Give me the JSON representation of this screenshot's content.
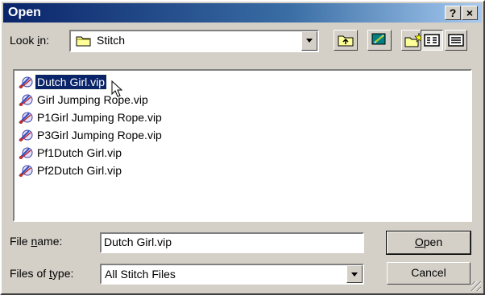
{
  "window": {
    "title": "Open",
    "help_label": "?",
    "close_label": "×"
  },
  "toolbar": {
    "look_in_label": "Look ",
    "look_in_accel": "i",
    "look_in_after": "n:",
    "look_in_value": "Stitch",
    "look_in_icon": "folder-icon",
    "buttons": [
      {
        "name": "up-one-level-button",
        "icon": "up-folder-icon"
      },
      {
        "name": "desktop-button",
        "icon": "desktop-icon"
      },
      {
        "name": "new-folder-button",
        "icon": "new-folder-icon"
      },
      {
        "name": "list-view-button",
        "icon": "list-view-icon",
        "pressed": true
      },
      {
        "name": "details-view-button",
        "icon": "details-view-icon",
        "pressed": false
      }
    ]
  },
  "files": [
    {
      "name": "Dutch Girl.vip",
      "selected": true
    },
    {
      "name": "Girl Jumping Rope.vip",
      "selected": false
    },
    {
      "name": "P1Girl Jumping Rope.vip",
      "selected": false
    },
    {
      "name": "P3Girl Jumping Rope.vip",
      "selected": false
    },
    {
      "name": "Pf1Dutch Girl.vip",
      "selected": false
    },
    {
      "name": "Pf2Dutch Girl.vip",
      "selected": false
    }
  ],
  "file_icon": "stitch-file-icon",
  "form": {
    "file_name_pre": "File ",
    "file_name_accel": "n",
    "file_name_post": "ame:",
    "file_name_value": "Dutch Girl.vip",
    "file_type_pre": "Files of ",
    "file_type_accel": "t",
    "file_type_post": "ype:",
    "file_type_value": "All Stitch Files"
  },
  "buttons": {
    "open_accel": "O",
    "open_rest": "pen",
    "cancel_label": "Cancel"
  },
  "colors": {
    "title_start": "#0a246a",
    "title_end": "#a6caf0",
    "selection": "#0a246a",
    "face": "#d4d0c8"
  }
}
